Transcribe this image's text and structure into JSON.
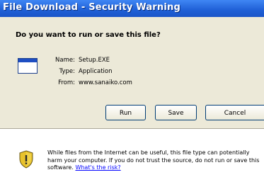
{
  "window": {
    "title": "File Download - Security Warning"
  },
  "dialog": {
    "question": "Do you want to run or save this file?",
    "fields": [
      {
        "label": "Name:",
        "value": "Setup.EXE"
      },
      {
        "label": "Type:",
        "value": "Application"
      },
      {
        "label": "From:",
        "value": "www.sanaiko.com"
      }
    ],
    "buttons": {
      "run": "Run",
      "save": "Save",
      "cancel": "Cancel"
    },
    "warning": {
      "text": "While files from the Internet can be useful, this file type can potentially harm your computer. If you do not trust the source, do not run or save this software.",
      "link": "What's the risk?"
    }
  },
  "icons": {
    "file": "application-file-icon",
    "warning": "security-shield-icon"
  },
  "colors": {
    "titlebar": "#1f5fd6",
    "panel": "#ece9d8",
    "link": "#0000ff",
    "shield": "#e8c22c"
  }
}
